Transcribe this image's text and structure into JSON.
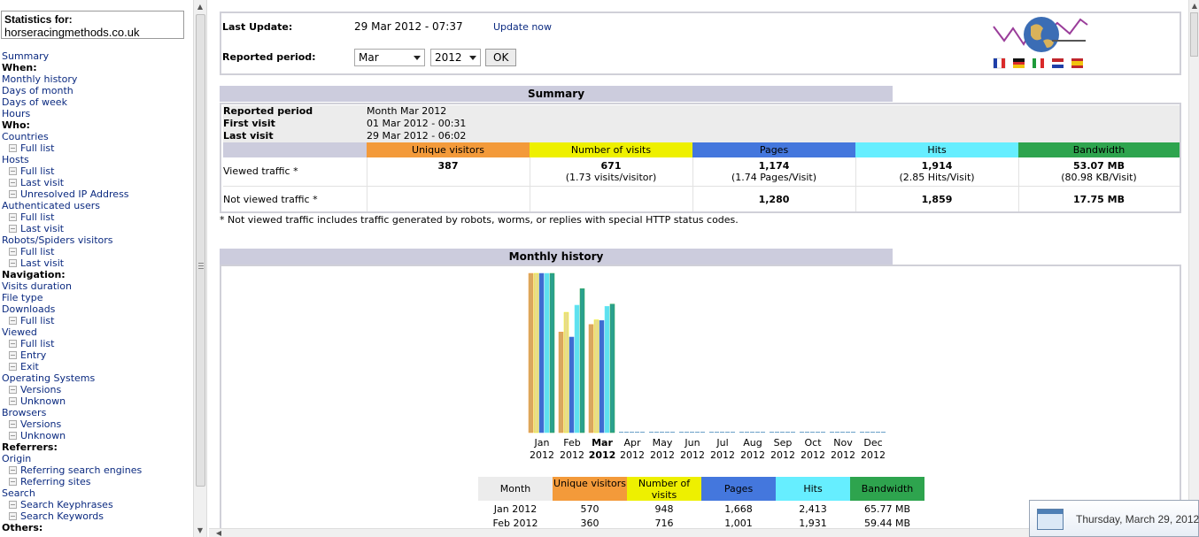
{
  "sidebar": {
    "title": "Statistics for:",
    "domain": "horseracingmethods.co.uk",
    "items": [
      {
        "label": "Summary",
        "type": "link"
      },
      {
        "label": "When:",
        "type": "header"
      },
      {
        "label": "Monthly history",
        "type": "link"
      },
      {
        "label": "Days of month",
        "type": "link"
      },
      {
        "label": "Days of week",
        "type": "link"
      },
      {
        "label": "Hours",
        "type": "link"
      },
      {
        "label": "Who:",
        "type": "header"
      },
      {
        "label": "Countries",
        "type": "link"
      },
      {
        "label": "Full list",
        "type": "sub"
      },
      {
        "label": "Hosts",
        "type": "link"
      },
      {
        "label": "Full list",
        "type": "sub"
      },
      {
        "label": "Last visit",
        "type": "sub"
      },
      {
        "label": "Unresolved IP Address",
        "type": "sub"
      },
      {
        "label": "Authenticated users",
        "type": "link"
      },
      {
        "label": "Full list",
        "type": "sub"
      },
      {
        "label": "Last visit",
        "type": "sub"
      },
      {
        "label": "Robots/Spiders visitors",
        "type": "link"
      },
      {
        "label": "Full list",
        "type": "sub"
      },
      {
        "label": "Last visit",
        "type": "sub"
      },
      {
        "label": "Navigation:",
        "type": "header"
      },
      {
        "label": "Visits duration",
        "type": "link"
      },
      {
        "label": "File type",
        "type": "link"
      },
      {
        "label": "Downloads",
        "type": "link"
      },
      {
        "label": "Full list",
        "type": "sub"
      },
      {
        "label": "Viewed",
        "type": "link"
      },
      {
        "label": "Full list",
        "type": "sub"
      },
      {
        "label": "Entry",
        "type": "sub"
      },
      {
        "label": "Exit",
        "type": "sub"
      },
      {
        "label": "Operating Systems",
        "type": "link"
      },
      {
        "label": "Versions",
        "type": "sub"
      },
      {
        "label": "Unknown",
        "type": "sub"
      },
      {
        "label": "Browsers",
        "type": "link"
      },
      {
        "label": "Versions",
        "type": "sub"
      },
      {
        "label": "Unknown",
        "type": "sub"
      },
      {
        "label": "Referrers:",
        "type": "header"
      },
      {
        "label": "Origin",
        "type": "link"
      },
      {
        "label": "Referring search engines",
        "type": "sub"
      },
      {
        "label": "Referring sites",
        "type": "sub"
      },
      {
        "label": "Search",
        "type": "link"
      },
      {
        "label": "Search Keyphrases",
        "type": "sub"
      },
      {
        "label": "Search Keywords",
        "type": "sub"
      },
      {
        "label": "Others:",
        "type": "header"
      }
    ]
  },
  "header": {
    "last_update_label": "Last Update:",
    "last_update_value": "29 Mar 2012 - 07:37",
    "update_now": "Update now",
    "period_label": "Reported period:",
    "month_select": "Mar",
    "year_select": "2012",
    "ok_button": "OK",
    "flags": [
      "fr",
      "de",
      "it",
      "nl",
      "es"
    ]
  },
  "summary": {
    "title": "Summary",
    "reported_period_label": "Reported period",
    "reported_period_value": "Month Mar 2012",
    "first_visit_label": "First visit",
    "first_visit_value": "01 Mar 2012 - 00:31",
    "last_visit_label": "Last visit",
    "last_visit_value": "29 Mar 2012 - 06:02",
    "columns": [
      "Unique visitors",
      "Number of visits",
      "Pages",
      "Hits",
      "Bandwidth"
    ],
    "viewed_label": "Viewed traffic *",
    "viewed": [
      {
        "main": "387",
        "sub": ""
      },
      {
        "main": "671",
        "sub": "(1.73 visits/visitor)"
      },
      {
        "main": "1,174",
        "sub": "(1.74 Pages/Visit)"
      },
      {
        "main": "1,914",
        "sub": "(2.85 Hits/Visit)"
      },
      {
        "main": "53.07 MB",
        "sub": "(80.98 KB/Visit)"
      }
    ],
    "not_viewed_label": "Not viewed traffic *",
    "not_viewed": [
      "",
      "",
      "1,280",
      "1,859",
      "17.75 MB"
    ],
    "note": "* Not viewed traffic includes traffic generated by robots, worms, or replies with special HTTP status codes."
  },
  "history": {
    "title": "Monthly history",
    "table_columns": [
      "Month",
      "Unique visitors",
      "Number of visits",
      "Pages",
      "Hits",
      "Bandwidth"
    ],
    "rows": [
      [
        "Jan 2012",
        "570",
        "948",
        "1,668",
        "2,413",
        "65.77 MB"
      ],
      [
        "Feb 2012",
        "360",
        "716",
        "1,001",
        "1,931",
        "59.44 MB"
      ]
    ]
  },
  "colors": {
    "unique": "#f39a3a",
    "visits": "#eef000",
    "pages": "#4477dd",
    "hits": "#66eeff",
    "bandwidth": "#2ea44e",
    "section_header": "#ccccdd"
  },
  "chart_data": {
    "type": "bar",
    "categories": [
      "Jan 2012",
      "Feb 2012",
      "Mar 2012",
      "Apr 2012",
      "May 2012",
      "Jun 2012",
      "Jul 2012",
      "Aug 2012",
      "Sep 2012",
      "Oct 2012",
      "Nov 2012",
      "Dec 2012"
    ],
    "month_labels": [
      "Jan",
      "Feb",
      "Mar",
      "Apr",
      "May",
      "Jun",
      "Jul",
      "Aug",
      "Sep",
      "Oct",
      "Nov",
      "Dec"
    ],
    "year_labels": [
      "2012",
      "2012",
      "2012",
      "2012",
      "2012",
      "2012",
      "2012",
      "2012",
      "2012",
      "2012",
      "2012",
      "2012"
    ],
    "highlight": "Mar",
    "series": [
      {
        "name": "Unique visitors",
        "values": [
          570,
          360,
          387,
          0,
          0,
          0,
          0,
          0,
          0,
          0,
          0,
          0
        ]
      },
      {
        "name": "Number of visits",
        "values": [
          948,
          716,
          671,
          0,
          0,
          0,
          0,
          0,
          0,
          0,
          0,
          0
        ]
      },
      {
        "name": "Pages",
        "values": [
          1668,
          1001,
          1174,
          0,
          0,
          0,
          0,
          0,
          0,
          0,
          0,
          0
        ]
      },
      {
        "name": "Hits",
        "values": [
          2413,
          1931,
          1914,
          0,
          0,
          0,
          0,
          0,
          0,
          0,
          0,
          0
        ]
      },
      {
        "name": "Bandwidth",
        "values": [
          65.77,
          59.44,
          53.07,
          0,
          0,
          0,
          0,
          0,
          0,
          0,
          0,
          0
        ]
      }
    ]
  },
  "taskbar": {
    "date": "Thursday, March 29, 2012"
  }
}
